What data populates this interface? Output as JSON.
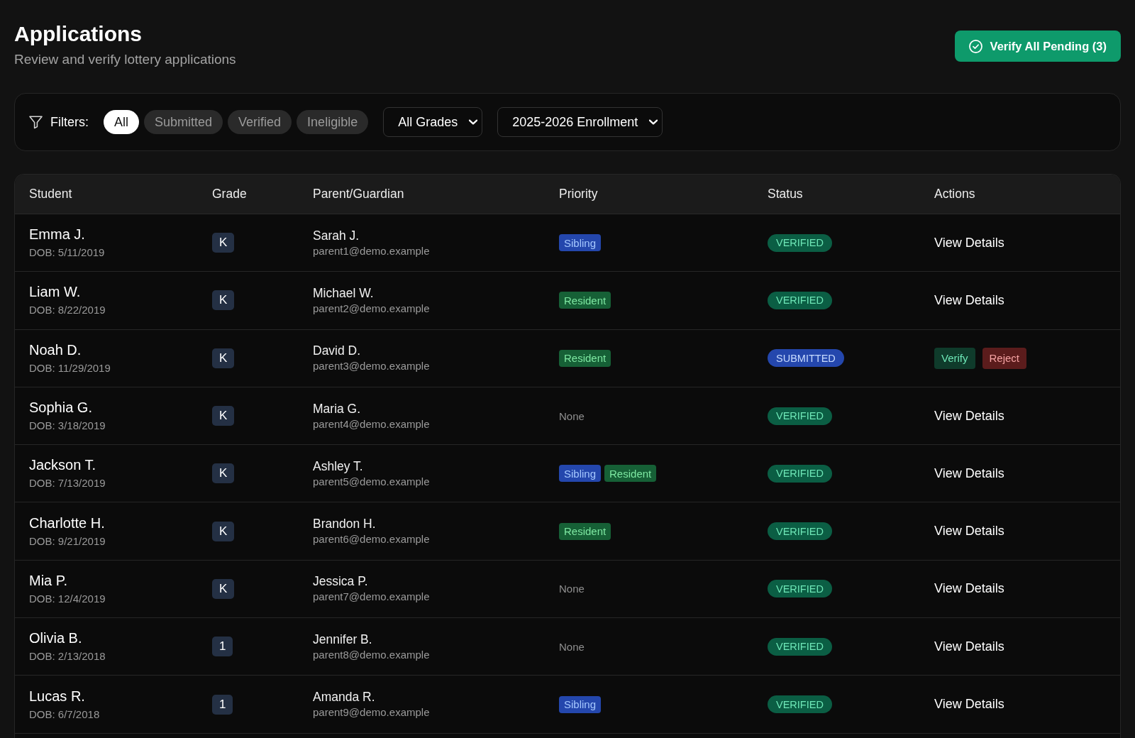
{
  "header": {
    "title": "Applications",
    "subtitle": "Review and verify lottery applications",
    "primary_action": {
      "label": "Verify All Pending (3)"
    }
  },
  "filters": {
    "label": "Filters:",
    "chips": [
      {
        "label": "All",
        "selected": true
      },
      {
        "label": "Submitted",
        "selected": false
      },
      {
        "label": "Verified",
        "selected": false
      },
      {
        "label": "Ineligible",
        "selected": false
      }
    ],
    "selects": [
      {
        "value": "All Grades"
      },
      {
        "value": "2025-2026 Enrollment"
      }
    ]
  },
  "table": {
    "columns": [
      "Student",
      "Grade",
      "Parent/Guardian",
      "Priority",
      "Status",
      "Actions"
    ],
    "rows": [
      {
        "student": "Emma J.",
        "dob": "DOB: 5/11/2019",
        "grade": "K",
        "parent": "Sarah J.",
        "email": "parent1@demo.example",
        "priority": [
          {
            "kind": "sibling",
            "label": "Sibling"
          }
        ],
        "status": {
          "kind": "verified",
          "label": "VERIFIED"
        },
        "actions": [
          {
            "kind": "link",
            "label": "View Details"
          }
        ]
      },
      {
        "student": "Liam W.",
        "dob": "DOB: 8/22/2019",
        "grade": "K",
        "parent": "Michael W.",
        "email": "parent2@demo.example",
        "priority": [
          {
            "kind": "resident",
            "label": "Resident"
          }
        ],
        "status": {
          "kind": "verified",
          "label": "VERIFIED"
        },
        "actions": [
          {
            "kind": "link",
            "label": "View Details"
          }
        ]
      },
      {
        "student": "Noah D.",
        "dob": "DOB: 11/29/2019",
        "grade": "K",
        "parent": "David D.",
        "email": "parent3@demo.example",
        "priority": [
          {
            "kind": "resident",
            "label": "Resident"
          }
        ],
        "status": {
          "kind": "submitted",
          "label": "SUBMITTED"
        },
        "actions": [
          {
            "kind": "verify",
            "label": "Verify"
          },
          {
            "kind": "reject",
            "label": "Reject"
          }
        ]
      },
      {
        "student": "Sophia G.",
        "dob": "DOB: 3/18/2019",
        "grade": "K",
        "parent": "Maria G.",
        "email": "parent4@demo.example",
        "priority": [
          {
            "kind": "none",
            "label": "None"
          }
        ],
        "status": {
          "kind": "verified",
          "label": "VERIFIED"
        },
        "actions": [
          {
            "kind": "link",
            "label": "View Details"
          }
        ]
      },
      {
        "student": "Jackson T.",
        "dob": "DOB: 7/13/2019",
        "grade": "K",
        "parent": "Ashley T.",
        "email": "parent5@demo.example",
        "priority": [
          {
            "kind": "sibling",
            "label": "Sibling"
          },
          {
            "kind": "resident",
            "label": "Resident"
          }
        ],
        "status": {
          "kind": "verified",
          "label": "VERIFIED"
        },
        "actions": [
          {
            "kind": "link",
            "label": "View Details"
          }
        ]
      },
      {
        "student": "Charlotte H.",
        "dob": "DOB: 9/21/2019",
        "grade": "K",
        "parent": "Brandon H.",
        "email": "parent6@demo.example",
        "priority": [
          {
            "kind": "resident",
            "label": "Resident"
          }
        ],
        "status": {
          "kind": "verified",
          "label": "VERIFIED"
        },
        "actions": [
          {
            "kind": "link",
            "label": "View Details"
          }
        ]
      },
      {
        "student": "Mia P.",
        "dob": "DOB: 12/4/2019",
        "grade": "K",
        "parent": "Jessica P.",
        "email": "parent7@demo.example",
        "priority": [
          {
            "kind": "none",
            "label": "None"
          }
        ],
        "status": {
          "kind": "verified",
          "label": "VERIFIED"
        },
        "actions": [
          {
            "kind": "link",
            "label": "View Details"
          }
        ]
      },
      {
        "student": "Olivia B.",
        "dob": "DOB: 2/13/2018",
        "grade": "1",
        "parent": "Jennifer B.",
        "email": "parent8@demo.example",
        "priority": [
          {
            "kind": "none",
            "label": "None"
          }
        ],
        "status": {
          "kind": "verified",
          "label": "VERIFIED"
        },
        "actions": [
          {
            "kind": "link",
            "label": "View Details"
          }
        ]
      },
      {
        "student": "Lucas R.",
        "dob": "DOB: 6/7/2018",
        "grade": "1",
        "parent": "Amanda R.",
        "email": "parent9@demo.example",
        "priority": [
          {
            "kind": "sibling",
            "label": "Sibling"
          }
        ],
        "status": {
          "kind": "verified",
          "label": "VERIFIED"
        },
        "actions": [
          {
            "kind": "link",
            "label": "View Details"
          }
        ]
      }
    ]
  }
}
